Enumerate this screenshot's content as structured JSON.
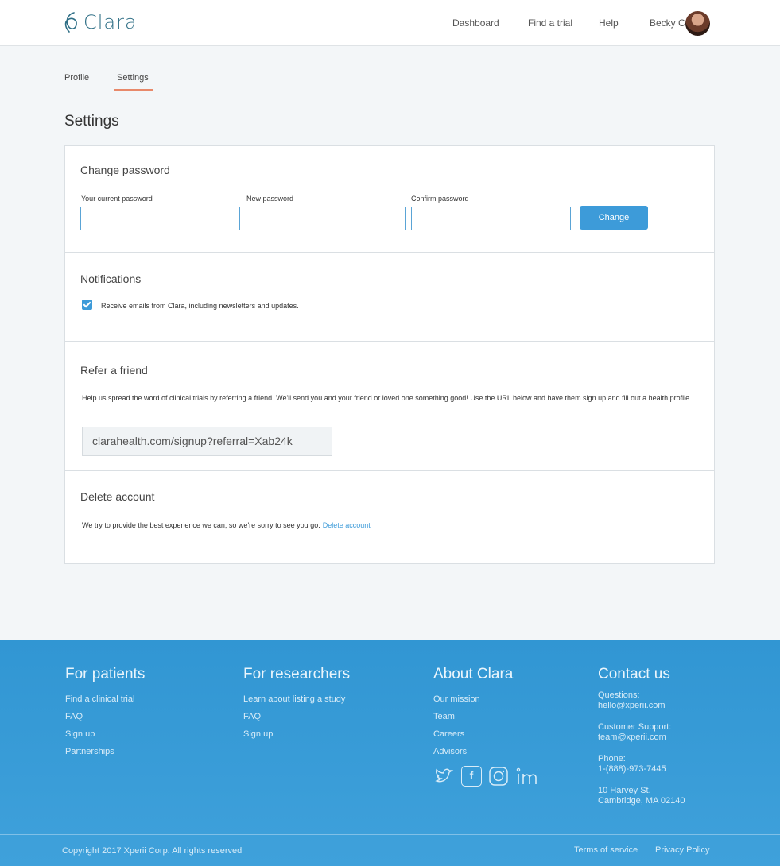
{
  "header": {
    "logo_text": "Clara",
    "nav": {
      "dashboard": "Dashboard",
      "find_trial": "Find a trial",
      "help": "Help",
      "user": "Becky C"
    }
  },
  "tabs": [
    {
      "label": "Profile",
      "active": false
    },
    {
      "label": "Settings",
      "active": true
    }
  ],
  "page_title": "Settings",
  "change_password": {
    "title": "Change password",
    "current_label": "Your current password",
    "current_value": "",
    "new_label": "New password",
    "new_value": "",
    "confirm_label": "Confirm password",
    "confirm_value": "",
    "button": "Change"
  },
  "notifications": {
    "title": "Notifications",
    "checkbox_label": "Receive emails from Clara, including newsletters and updates.",
    "checked": true
  },
  "refer": {
    "title": "Refer a friend",
    "text": "Help us spread the word of clinical trials by referring a friend. We'll send you and your friend or loved one something good! Use the URL below and have them sign up and fill out a health profile.",
    "url": "clarahealth.com/signup?referral=Xab24k"
  },
  "delete_account": {
    "title": "Delete account",
    "text": "We try to provide the best experience we can, so we're sorry to see you go.",
    "link": "Delete account"
  },
  "footer": {
    "patients": {
      "title": "For patients",
      "links": [
        "Find a clinical trial",
        "FAQ",
        "Sign up",
        "Partnerships"
      ]
    },
    "researchers": {
      "title": "For researchers",
      "links": [
        "Learn about listing a study",
        "FAQ",
        "Sign up"
      ]
    },
    "about": {
      "title": "About Clara",
      "links": [
        "Our mission",
        "Team",
        "Careers",
        "Advisors"
      ],
      "socials": [
        "twitter-icon",
        "facebook-icon",
        "instagram-icon",
        "linkedin-icon"
      ]
    },
    "contact": {
      "title": "Contact us",
      "questions_label": "Questions:",
      "questions_email": "hello@xperii.com",
      "support_label": "Customer Support:",
      "support_email": "team@xperii.com",
      "phone_label": "Phone:",
      "phone": "1-(888)-973-7445",
      "address_1": "10 Harvey St.",
      "address_2": "Cambridge, MA 02140"
    },
    "copyright": "Copyright 2017 Xperii Corp. All rights reserved",
    "terms": "Terms of service",
    "privacy": "Privacy Policy"
  },
  "colors": {
    "accent": "#3d9bd9",
    "tab_underline": "#e8896a",
    "footer_bg": "#3196d3"
  }
}
